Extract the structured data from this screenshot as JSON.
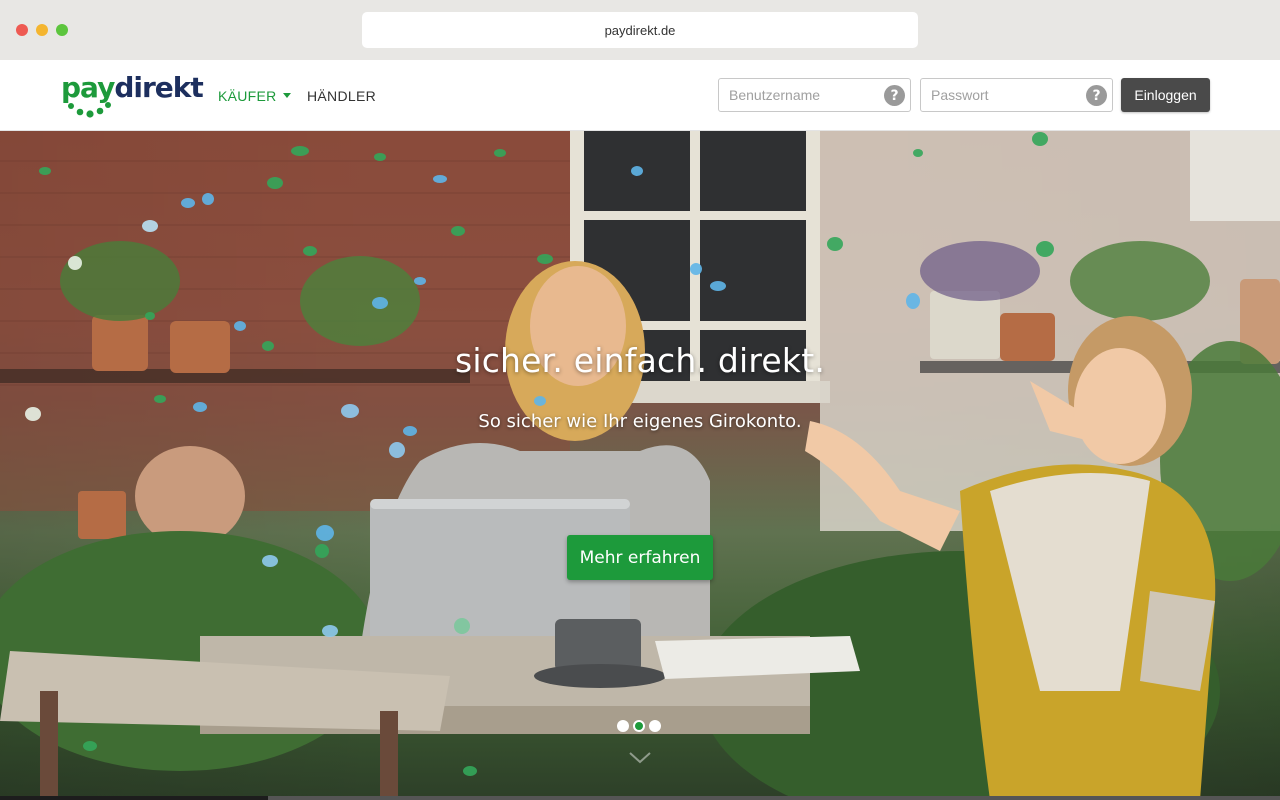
{
  "browser": {
    "url": "paydirekt.de"
  },
  "header": {
    "logo": {
      "part1": "pay",
      "part2": "direkt"
    },
    "nav": {
      "kaeufer_label": "KÄUFER",
      "haendler_label": "HÄNDLER"
    },
    "login": {
      "username_placeholder": "Benutzername",
      "username_value": "",
      "password_placeholder": "Passwort",
      "password_value": "",
      "help_glyph": "?",
      "submit_label": "Einloggen"
    }
  },
  "hero": {
    "title": "sicher. einfach. direkt.",
    "subtitle": "So sicher wie Ihr eigenes Girokonto.",
    "cta_label": "Mehr erfahren",
    "carousel": {
      "count": 3,
      "active_index": 1
    }
  },
  "colors": {
    "brand_green": "#1d9a3b",
    "brand_navy": "#1d2f5e",
    "login_button": "#4a4a4a"
  },
  "icons": [
    "caret-down-icon",
    "help-icon",
    "chevron-down-icon"
  ]
}
